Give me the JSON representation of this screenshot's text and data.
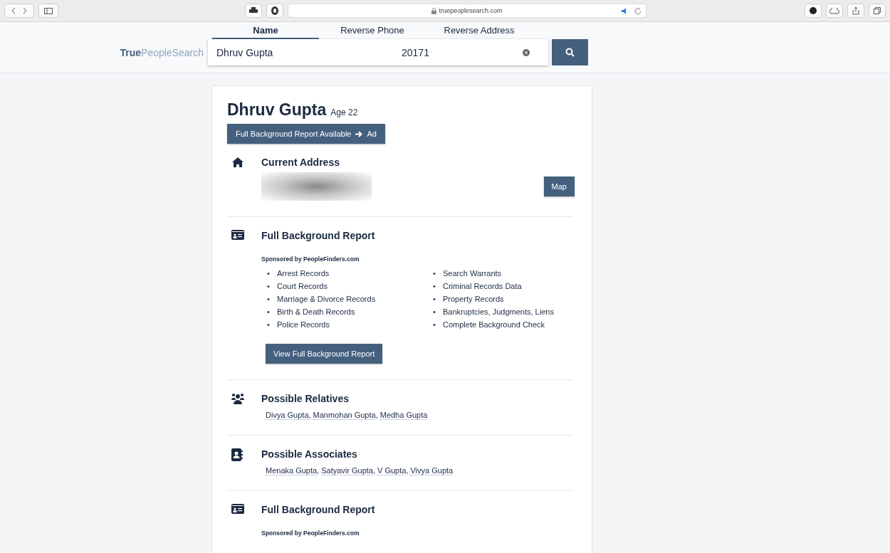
{
  "browser": {
    "url": "truepeoplesearch.com"
  },
  "site": {
    "logo_bold": "True",
    "logo_light": "PeopleSearch"
  },
  "list_style": {
    "bullet": "•",
    "separator": ","
  },
  "search_tabs": [
    {
      "label": "Name",
      "selected": true
    },
    {
      "label": "Reverse Phone",
      "selected": false
    },
    {
      "label": "Reverse Address",
      "selected": false
    }
  ],
  "search": {
    "name_value": "Dhruv Gupta",
    "location_value": "20171"
  },
  "person": {
    "name": "Dhruv Gupta",
    "age": "Age 22",
    "ad_button": "Full Background Report Available",
    "ad_label": "Ad"
  },
  "sections": [
    {
      "kind": "address",
      "title": "Current Address",
      "button": "Map"
    },
    {
      "kind": "background",
      "title": "Full Background Report",
      "sponsor": "Sponsored by PeopleFinders.com",
      "items_left": [
        "Arrest Records",
        "Court Records",
        "Marriage & Divorce Records",
        "Birth & Death Records",
        "Police Records"
      ],
      "items_right": [
        "Search Warrants",
        "Criminal Records Data",
        "Property Records",
        "Bankruptcies, Judgments, Liens",
        "Complete Background Check"
      ],
      "button": "View Full Background Report"
    },
    {
      "kind": "relatives",
      "title": "Possible Relatives",
      "people": [
        "Divya Gupta",
        "Manmohan Gupta",
        "Medha Gupta"
      ]
    },
    {
      "kind": "associates",
      "title": "Possible Associates",
      "people": [
        "Menaka Gupta",
        "Satyavir Gupta",
        "V Gupta",
        "Vivya Gupta"
      ]
    },
    {
      "kind": "background",
      "title": "Full Background Report",
      "sponsor": "Sponsored by PeopleFinders.com"
    }
  ]
}
